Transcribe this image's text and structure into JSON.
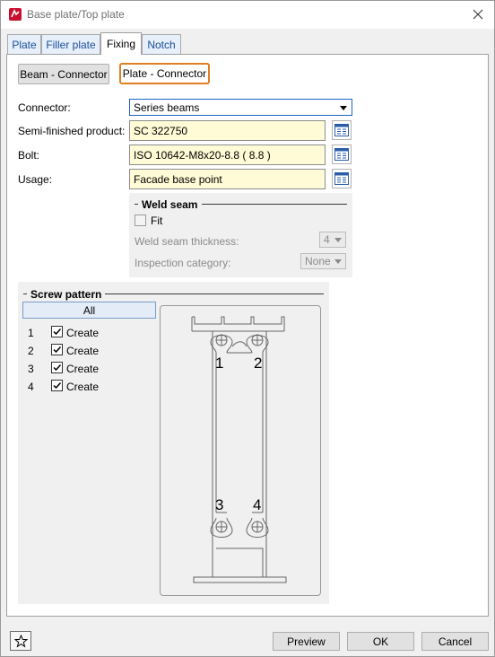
{
  "window": {
    "title": "Base plate/Top plate"
  },
  "tabs": [
    {
      "label": "Plate",
      "active": false
    },
    {
      "label": "Filler plate",
      "active": false
    },
    {
      "label": "Fixing",
      "active": true
    },
    {
      "label": "Notch",
      "active": false
    }
  ],
  "mode_buttons": {
    "beam_connector": "Beam - Connector",
    "plate_connector": "Plate - Connector"
  },
  "form": {
    "connector": {
      "label": "Connector:",
      "value": "Series beams"
    },
    "semi_finished": {
      "label": "Semi-finished product:",
      "value": "SC  322750"
    },
    "bolt": {
      "label": "Bolt:",
      "value": "ISO 10642-M8x20-8.8  ( 8.8 )"
    },
    "usage": {
      "label": "Usage:",
      "value": "Facade base point"
    }
  },
  "weld_seam": {
    "title": "Weld seam",
    "fit_label": "Fit",
    "fit_checked": false,
    "thickness_label": "Weld seam thickness:",
    "thickness_value": "4",
    "inspection_label": "Inspection category:",
    "inspection_value": "None"
  },
  "screw_pattern": {
    "title": "Screw pattern",
    "all_button": "All",
    "rows": [
      {
        "num": "1",
        "label": "Create",
        "checked": true
      },
      {
        "num": "2",
        "label": "Create",
        "checked": true
      },
      {
        "num": "3",
        "label": "Create",
        "checked": true
      },
      {
        "num": "4",
        "label": "Create",
        "checked": true
      }
    ],
    "diagram_labels": [
      "1",
      "2",
      "3",
      "4"
    ]
  },
  "footer": {
    "preview": "Preview",
    "ok": "OK",
    "cancel": "Cancel"
  },
  "icons": {
    "app": "app-icon",
    "close": "close-icon",
    "library": "library-icon",
    "favorite": "star-icon"
  },
  "colors": {
    "accent": "#e07e23",
    "field_bg": "#fffbd6",
    "tab_text": "#1a4d9a"
  }
}
